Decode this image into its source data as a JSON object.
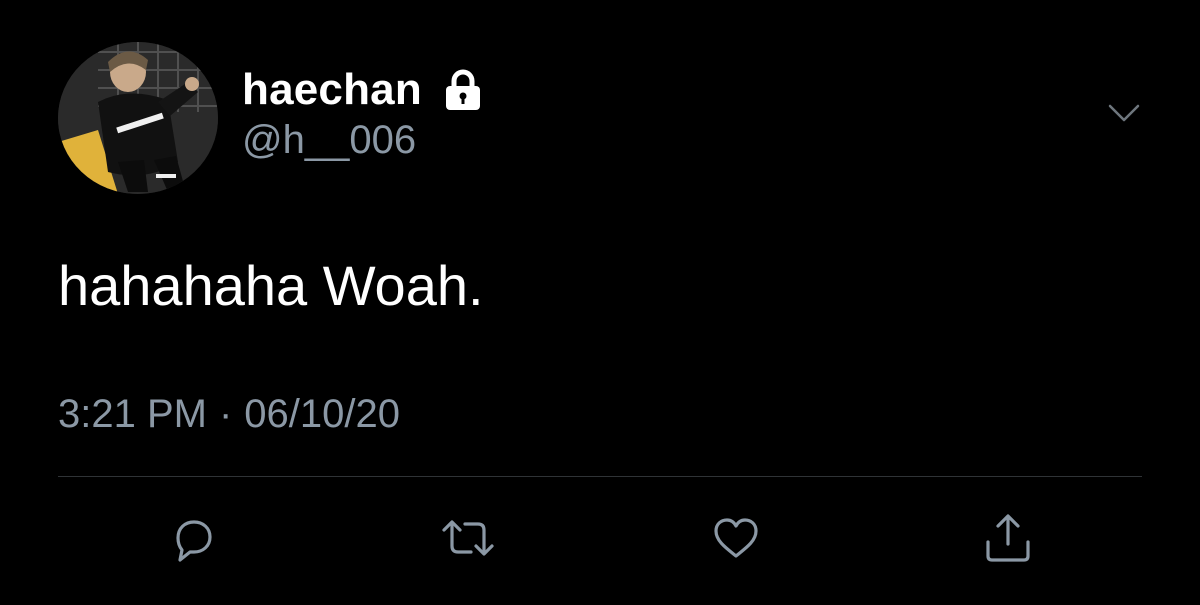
{
  "tweet": {
    "author": {
      "display_name": "haechan",
      "handle": "@h__006",
      "protected_icon": "lock-icon",
      "avatar": "profile-photo"
    },
    "text": "hahahaha Woah.",
    "time": "3:21 PM",
    "separator": "·",
    "date": "06/10/20",
    "menu_icon": "chevron-down-icon",
    "actions": [
      {
        "name": "reply",
        "icon": "comment-icon"
      },
      {
        "name": "retweet",
        "icon": "retweet-icon"
      },
      {
        "name": "like",
        "icon": "heart-icon"
      },
      {
        "name": "share",
        "icon": "share-icon"
      }
    ]
  },
  "colors": {
    "background": "#000000",
    "text_primary": "#ffffff",
    "text_secondary": "#8b98a5",
    "divider": "#2f3336"
  }
}
